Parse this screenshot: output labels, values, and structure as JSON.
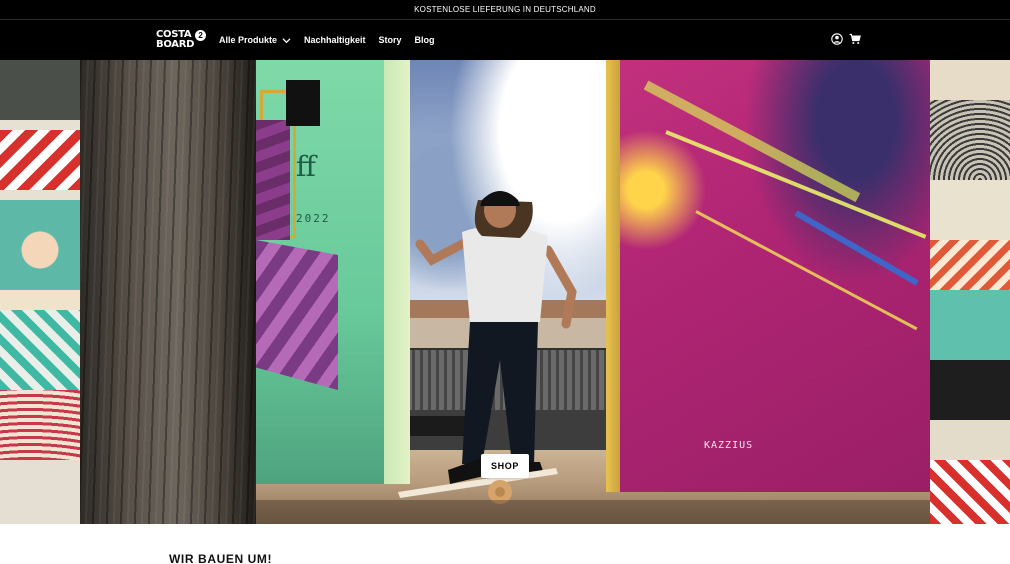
{
  "announcement": {
    "text": "KOSTENLOSE LIEFERUNG IN DEUTSCHLAND"
  },
  "header": {
    "logo": {
      "text": "COSTA\nBOARD",
      "badge": "2"
    },
    "nav": [
      {
        "label": "Alle Produkte",
        "has_dropdown": true
      },
      {
        "label": "Nachhaltigkeit"
      },
      {
        "label": "Story"
      },
      {
        "label": "Blog"
      }
    ],
    "icons": [
      "account-icon",
      "cart-icon"
    ]
  },
  "hero": {
    "graffiti_text": {
      "numbers": "2022",
      "tag": "KAZZIUS",
      "monogram": "ff"
    },
    "cta": {
      "label": "SHOP"
    }
  },
  "section": {
    "title": "WIR BAUEN UM!"
  },
  "colors": {
    "header_bg": "#000000",
    "accent": "#ffffff"
  }
}
